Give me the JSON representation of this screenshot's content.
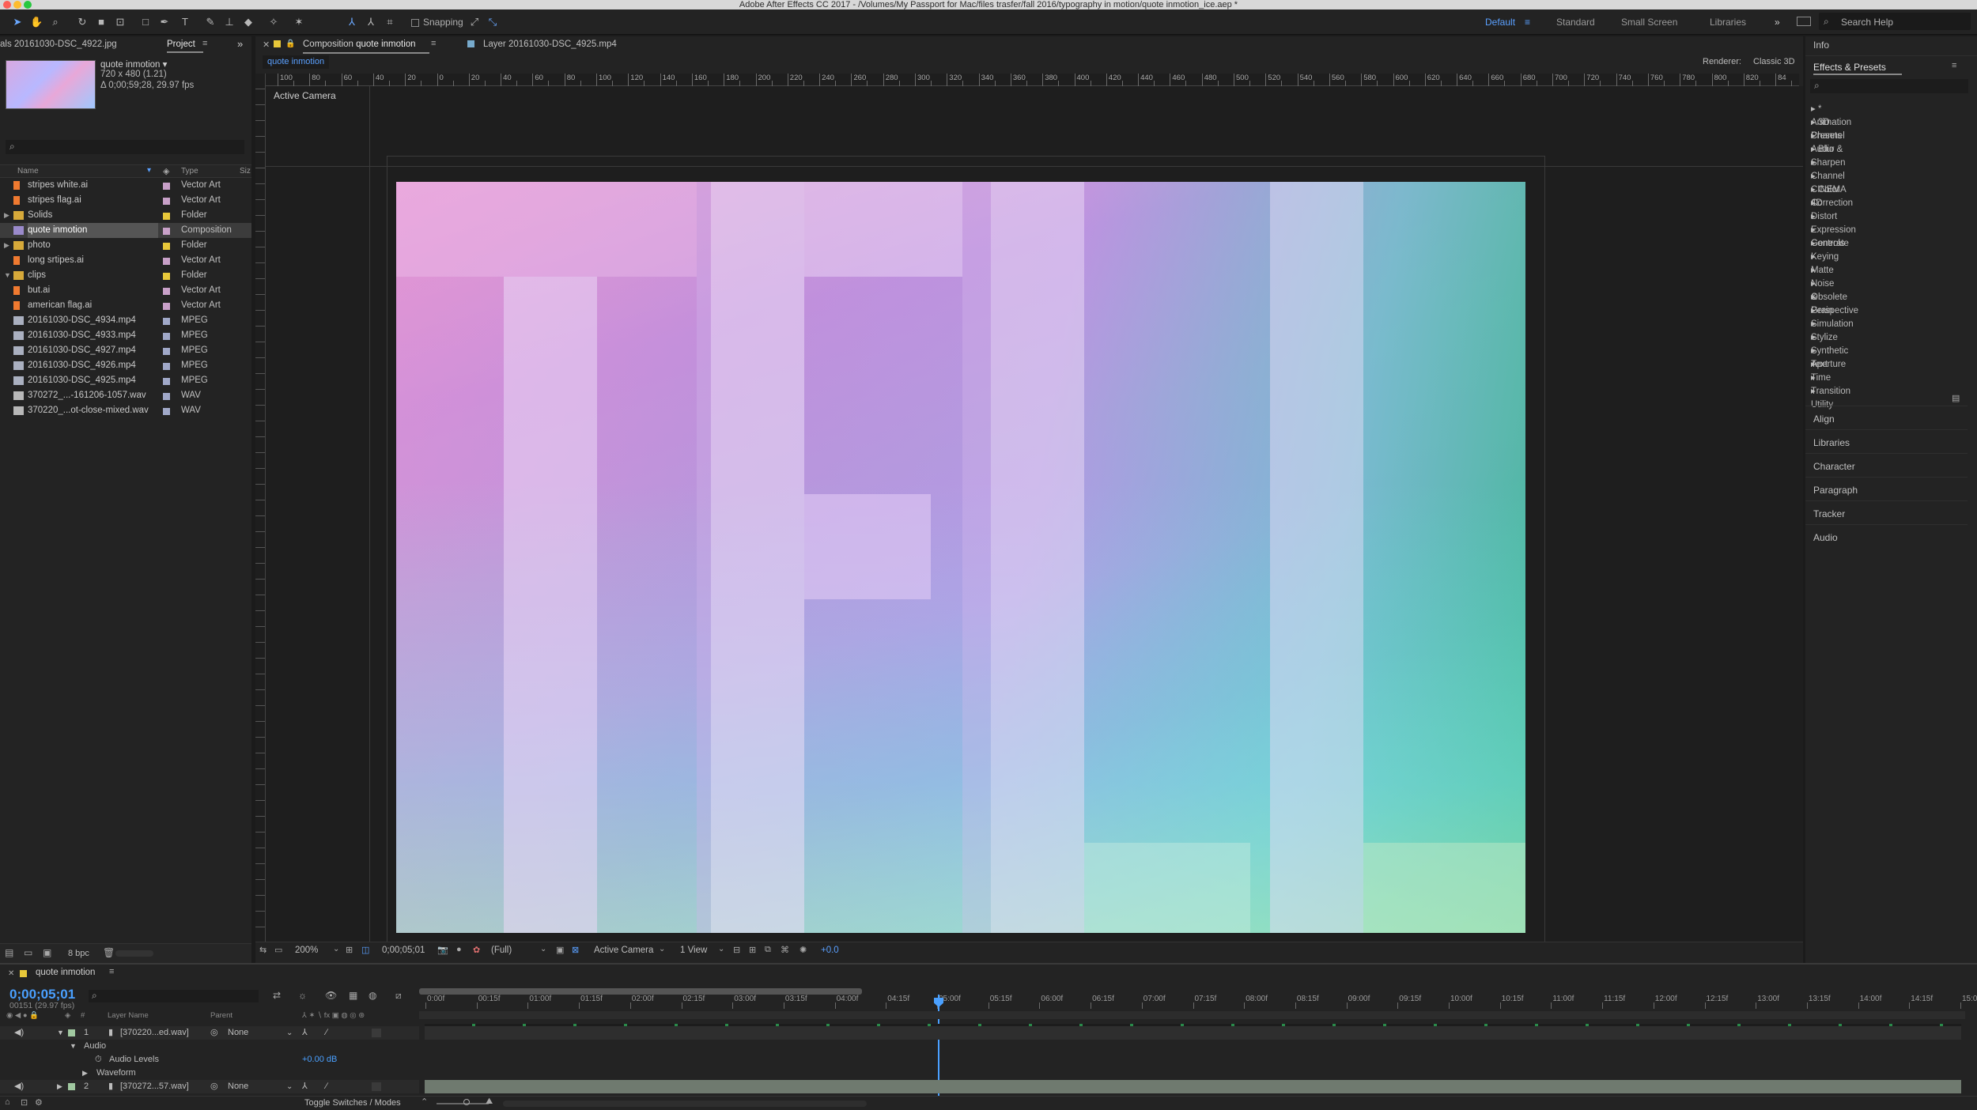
{
  "app": {
    "title": "Adobe After Effects CC 2017 - /Volumes/My Passport for Mac/files trasfer/fall 2016/typography in motion/quote inmotion_ice.aep *"
  },
  "toolbar": {
    "snapping_label": "Snapping",
    "workspaces": [
      "Default",
      "Standard",
      "Small Screen",
      "Libraries"
    ],
    "active_workspace": "Default",
    "search_placeholder": "Search Help"
  },
  "project": {
    "footage_tab": "als 20161030-DSC_4922.jpg",
    "project_tab": "Project",
    "comp_name": "quote inmotion ▾",
    "comp_dims": "720 x 480 (1.21)",
    "comp_duration": "Δ 0;00;59;28, 29.97 fps",
    "col_name": "Name",
    "col_type": "Type",
    "col_size": "Siz",
    "items": [
      {
        "name": "stripes white.ai",
        "type": "Vector Art",
        "color": "#c8a0c8",
        "icon": "ai",
        "indent": 0,
        "twirl": ""
      },
      {
        "name": "stripes flag.ai",
        "type": "Vector Art",
        "color": "#c8a0c8",
        "icon": "ai",
        "indent": 0,
        "twirl": ""
      },
      {
        "name": "Solids",
        "type": "Folder",
        "color": "#e8c83a",
        "icon": "folder",
        "indent": 0,
        "twirl": "▶"
      },
      {
        "name": "quote inmotion",
        "type": "Composition",
        "color": "#c8a0c8",
        "icon": "comp",
        "indent": 0,
        "twirl": "",
        "selected": true
      },
      {
        "name": "photo",
        "type": "Folder",
        "color": "#e8c83a",
        "icon": "folder",
        "indent": 0,
        "twirl": "▶"
      },
      {
        "name": "long srtipes.ai",
        "type": "Vector Art",
        "color": "#c8a0c8",
        "icon": "ai",
        "indent": 0,
        "twirl": ""
      },
      {
        "name": "clips",
        "type": "Folder",
        "color": "#e8c83a",
        "icon": "folder",
        "indent": 0,
        "twirl": "▼"
      },
      {
        "name": "but.ai",
        "type": "Vector Art",
        "color": "#c8a0c8",
        "icon": "ai",
        "indent": 0,
        "twirl": ""
      },
      {
        "name": "american flag.ai",
        "type": "Vector Art",
        "color": "#c8a0c8",
        "icon": "ai",
        "indent": 0,
        "twirl": ""
      },
      {
        "name": "20161030-DSC_4934.mp4",
        "type": "MPEG",
        "color": "#a0a8c8",
        "icon": "movie",
        "indent": 0,
        "twirl": ""
      },
      {
        "name": "20161030-DSC_4933.mp4",
        "type": "MPEG",
        "color": "#a0a8c8",
        "icon": "movie",
        "indent": 0,
        "twirl": ""
      },
      {
        "name": "20161030-DSC_4927.mp4",
        "type": "MPEG",
        "color": "#a0a8c8",
        "icon": "movie",
        "indent": 0,
        "twirl": ""
      },
      {
        "name": "20161030-DSC_4926.mp4",
        "type": "MPEG",
        "color": "#a0a8c8",
        "icon": "movie",
        "indent": 0,
        "twirl": ""
      },
      {
        "name": "20161030-DSC_4925.mp4",
        "type": "MPEG",
        "color": "#a0a8c8",
        "icon": "movie",
        "indent": 0,
        "twirl": ""
      },
      {
        "name": "370272_...-161206-1057.wav",
        "type": "WAV",
        "color": "#a0a8c8",
        "icon": "audio",
        "indent": 0,
        "twirl": ""
      },
      {
        "name": "370220_...ot-close-mixed.wav",
        "type": "WAV",
        "color": "#a0a8c8",
        "icon": "audio",
        "indent": 0,
        "twirl": ""
      }
    ],
    "bpc": "8 bpc"
  },
  "viewer": {
    "tab_comp_prefix": "Composition",
    "tab_comp_name": "quote inmotion",
    "tab_layer": "Layer 20161030-DSC_4925.mp4",
    "sub_tab": "quote inmotion",
    "renderer_label": "Renderer:",
    "renderer_value": "Classic 3D",
    "camera_label": "Active Camera",
    "ruler_labels": [
      "100",
      "80",
      "60",
      "40",
      "20",
      "0",
      "20",
      "40",
      "60",
      "80",
      "100",
      "120",
      "140",
      "160",
      "180",
      "200",
      "220",
      "240",
      "260",
      "280",
      "300",
      "320",
      "340",
      "360",
      "380",
      "400",
      "420",
      "440",
      "460",
      "480",
      "500",
      "520",
      "540",
      "560",
      "580",
      "600",
      "620",
      "640",
      "660",
      "680",
      "700",
      "720",
      "740",
      "760",
      "780",
      "800",
      "820",
      "84"
    ],
    "zoom": "200%",
    "timecode": "0;00;05;01",
    "resolution": "(Full)",
    "view_camera": "Active Camera",
    "views": "1 View",
    "exposure": "+0.0"
  },
  "effects": {
    "info_tab": "Info",
    "title": "Effects & Presets",
    "items": [
      "* Animation Presets",
      "3D Channel",
      "Audio",
      "Blur & Sharpen",
      "Channel",
      "CINEMA 4D",
      "Color Correction",
      "Distort",
      "Expression Controls",
      "Generate",
      "Keying",
      "Matte",
      "Noise & Grain",
      "Obsolete",
      "Perspective",
      "Simulation",
      "Stylize",
      "Synthetic Aperture",
      "Text",
      "Time",
      "Transition",
      "Utility"
    ],
    "panels": [
      "Align",
      "Libraries",
      "Character",
      "Paragraph",
      "Tracker",
      "Audio"
    ]
  },
  "timeline": {
    "comp_tab": "quote inmotion",
    "timecode": "0;00;05;01",
    "frames": "00151 (29.97 fps)",
    "col_layer_name": "Layer Name",
    "col_parent": "Parent",
    "ruler": [
      "0:00f",
      "00:15f",
      "01:00f",
      "01:15f",
      "02:00f",
      "02:15f",
      "03:00f",
      "03:15f",
      "04:00f",
      "04:15f",
      "05:00f",
      "05:15f",
      "06:00f",
      "06:15f",
      "07:00f",
      "07:15f",
      "08:00f",
      "08:15f",
      "09:00f",
      "09:15f",
      "10:00f",
      "10:15f",
      "11:00f",
      "11:15f",
      "12:00f",
      "12:15f",
      "13:00f",
      "13:15f",
      "14:00f",
      "14:15f",
      "15:0"
    ],
    "layers": [
      {
        "num": "1",
        "name": "[370220...ed.wav]",
        "parent": "None"
      },
      {
        "num": "2",
        "name": "[370272...57.wav]",
        "parent": "None"
      }
    ],
    "audio_label": "Audio",
    "audio_levels_label": "Audio Levels",
    "audio_levels_value": "+0.00 dB",
    "waveform_label": "Waveform",
    "toggle_label": "Toggle Switches / Modes"
  }
}
